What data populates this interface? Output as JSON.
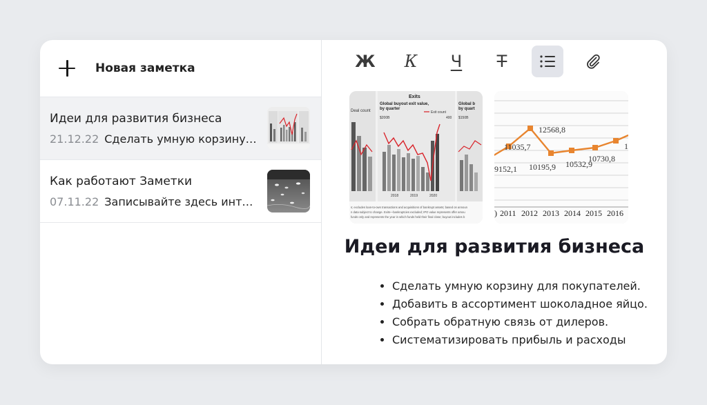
{
  "new_note": {
    "label": "Новая заметка",
    "icon": "plus-icon"
  },
  "notes": [
    {
      "title": "Идеи для развития бизнеса",
      "date": "21.12.22",
      "preview": "Сделать умную корзину ...",
      "thumbnail": "chart-thumbnail"
    },
    {
      "title": "Как работают Заметки",
      "date": "07.11.22",
      "preview": "Записывайте здесь инте...",
      "thumbnail": "photo-thumbnail"
    }
  ],
  "toolbar": {
    "bold": "Ж",
    "italic": "К",
    "underline": "Ч",
    "strike": "Т",
    "list_icon": "list-icon",
    "attach_icon": "paperclip-icon"
  },
  "images": {
    "chart1": {
      "heading": "Exits",
      "subtitle_line1": "Global buyout exit value,",
      "subtitle_line2": "by quarter",
      "legend": "Exit count",
      "y_left": "$200B",
      "y_right": "400",
      "left_label": "Deal count",
      "right_title_line1": "Global b",
      "right_title_line2": "by quart",
      "right_y": "$150B",
      "years": [
        "2018",
        "2019",
        "2020"
      ],
      "footer_line1": "s; excludes loan-to-own transactions and acquisitions of bankrupt assets; based on announ",
      "footer_line2": "n data subject to change. Exits—bankruptcies excluded; IPO value represents offer amou",
      "footer_line3": "funds only and represents the year in which funds held their final close; buyout includes b"
    },
    "chart2": {
      "labels": [
        "9152,1",
        "11035,7",
        "12568,8",
        "10195,9",
        "10532,9",
        "10730,8",
        "1"
      ],
      "years": [
        "2011",
        "2012",
        "2013",
        "2014",
        "2015",
        "2016"
      ],
      "left_fragment": ")"
    }
  },
  "document": {
    "title": "Идеи для развития бизнеса",
    "bullets": [
      "Сделать умную корзину для покупателей.",
      "Добавить в ассортимент шоколадное яйцо.",
      "Собрать обратную связь от дилеров.",
      "Систематизировать прибыль и расходы"
    ]
  },
  "colors": {
    "background": "#e9ebee",
    "active_item": "#f1f2f4",
    "active_tool": "#e2e4ea",
    "line_orange": "#e8852f",
    "chart_red": "#d9242b"
  }
}
